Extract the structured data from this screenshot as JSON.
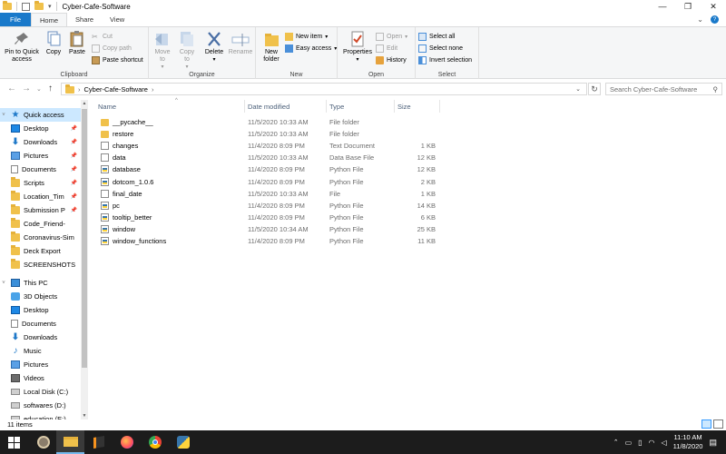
{
  "window": {
    "title": "Cyber-Cafe-Software",
    "controls": [
      "minimize-icon",
      "maximize-icon",
      "close-icon"
    ]
  },
  "ribbon_tabs": [
    {
      "label": "File"
    },
    {
      "label": "Home"
    },
    {
      "label": "Share"
    },
    {
      "label": "View"
    }
  ],
  "ribbon": {
    "clipboard": {
      "label": "Clipboard",
      "pin": "Pin to Quick access",
      "copy": "Copy",
      "paste": "Paste",
      "cut": "Cut",
      "copy_path": "Copy path",
      "paste_shortcut": "Paste shortcut"
    },
    "organize": {
      "label": "Organize",
      "move_to": "Move to",
      "copy_to": "Copy to",
      "delete": "Delete",
      "rename": "Rename"
    },
    "new": {
      "label": "New",
      "new_folder": "New folder",
      "new_item": "New item",
      "easy_access": "Easy access"
    },
    "open": {
      "label": "Open",
      "properties": "Properties",
      "open": "Open",
      "edit": "Edit",
      "history": "History"
    },
    "select": {
      "label": "Select",
      "select_all": "Select all",
      "select_none": "Select none",
      "invert": "Invert selection"
    }
  },
  "address": {
    "path": "Cyber-Cafe-Software",
    "search_placeholder": "Search Cyber-Cafe-Software"
  },
  "nav": {
    "quick_access": "Quick access",
    "items": [
      {
        "label": "Desktop",
        "icon": "desktop-icon",
        "pinned": true
      },
      {
        "label": "Downloads",
        "icon": "download-icon",
        "pinned": true
      },
      {
        "label": "Pictures",
        "icon": "pictures-icon",
        "pinned": true
      },
      {
        "label": "Documents",
        "icon": "documents-icon",
        "pinned": true
      },
      {
        "label": "Scripts",
        "icon": "folder-icon",
        "pinned": true
      },
      {
        "label": "Location_Tim",
        "icon": "folder-icon",
        "pinned": true
      },
      {
        "label": "Submission P",
        "icon": "folder-icon",
        "pinned": true
      },
      {
        "label": "Code_Friend-",
        "icon": "folder-icon",
        "pinned": false
      },
      {
        "label": "Coronavirus-Sim",
        "icon": "folder-icon",
        "pinned": false
      },
      {
        "label": "Deck Export",
        "icon": "folder-icon",
        "pinned": false
      },
      {
        "label": "SCREENSHOTS",
        "icon": "folder-icon",
        "pinned": false
      }
    ],
    "this_pc": "This PC",
    "pc_items": [
      {
        "label": "3D Objects",
        "icon": "3d-objects-icon"
      },
      {
        "label": "Desktop",
        "icon": "desktop-icon"
      },
      {
        "label": "Documents",
        "icon": "documents-icon"
      },
      {
        "label": "Downloads",
        "icon": "download-icon"
      },
      {
        "label": "Music",
        "icon": "music-icon"
      },
      {
        "label": "Pictures",
        "icon": "pictures-icon"
      },
      {
        "label": "Videos",
        "icon": "videos-icon"
      },
      {
        "label": "Local Disk (C:)",
        "icon": "disk-icon"
      },
      {
        "label": "softwares (D:)",
        "icon": "disk-icon"
      },
      {
        "label": "education (E:)",
        "icon": "disk-icon"
      }
    ]
  },
  "columns": {
    "name": "Name",
    "date": "Date modified",
    "type": "Type",
    "size": "Size"
  },
  "files": [
    {
      "name": "__pycache__",
      "date": "11/5/2020 10:33 AM",
      "type": "File folder",
      "size": "",
      "icon": "folder"
    },
    {
      "name": "restore",
      "date": "11/5/2020 10:33 AM",
      "type": "File folder",
      "size": "",
      "icon": "folder"
    },
    {
      "name": "changes",
      "date": "11/4/2020 8:09 PM",
      "type": "Text Document",
      "size": "1 KB",
      "icon": "text"
    },
    {
      "name": "data",
      "date": "11/5/2020 10:33 AM",
      "type": "Data Base File",
      "size": "12 KB",
      "icon": "db"
    },
    {
      "name": "database",
      "date": "11/4/2020 8:09 PM",
      "type": "Python File",
      "size": "12 KB",
      "icon": "py"
    },
    {
      "name": "dotcom_1.0.6",
      "date": "11/4/2020 8:09 PM",
      "type": "Python File",
      "size": "2 KB",
      "icon": "py"
    },
    {
      "name": "final_date",
      "date": "11/5/2020 10:33 AM",
      "type": "File",
      "size": "1 KB",
      "icon": "file"
    },
    {
      "name": "pc",
      "date": "11/4/2020 8:09 PM",
      "type": "Python File",
      "size": "14 KB",
      "icon": "py"
    },
    {
      "name": "tooltip_better",
      "date": "11/4/2020 8:09 PM",
      "type": "Python File",
      "size": "6 KB",
      "icon": "py"
    },
    {
      "name": "window",
      "date": "11/5/2020 10:34 AM",
      "type": "Python File",
      "size": "25 KB",
      "icon": "py"
    },
    {
      "name": "window_functions",
      "date": "11/4/2020 8:09 PM",
      "type": "Python File",
      "size": "11 KB",
      "icon": "py"
    }
  ],
  "status": {
    "count": "11 items"
  },
  "taskbar": {
    "time": "11:10 AM",
    "date": "11/8/2020",
    "apps": [
      "windows-icon",
      "gimp-icon",
      "file-explorer-icon",
      "sublime-icon",
      "firefox-icon",
      "chrome-icon",
      "python-icon"
    ]
  },
  "colors": {
    "accent": "#1979ca",
    "selection": "#cce8ff",
    "taskbar": "#1c1c1c"
  }
}
